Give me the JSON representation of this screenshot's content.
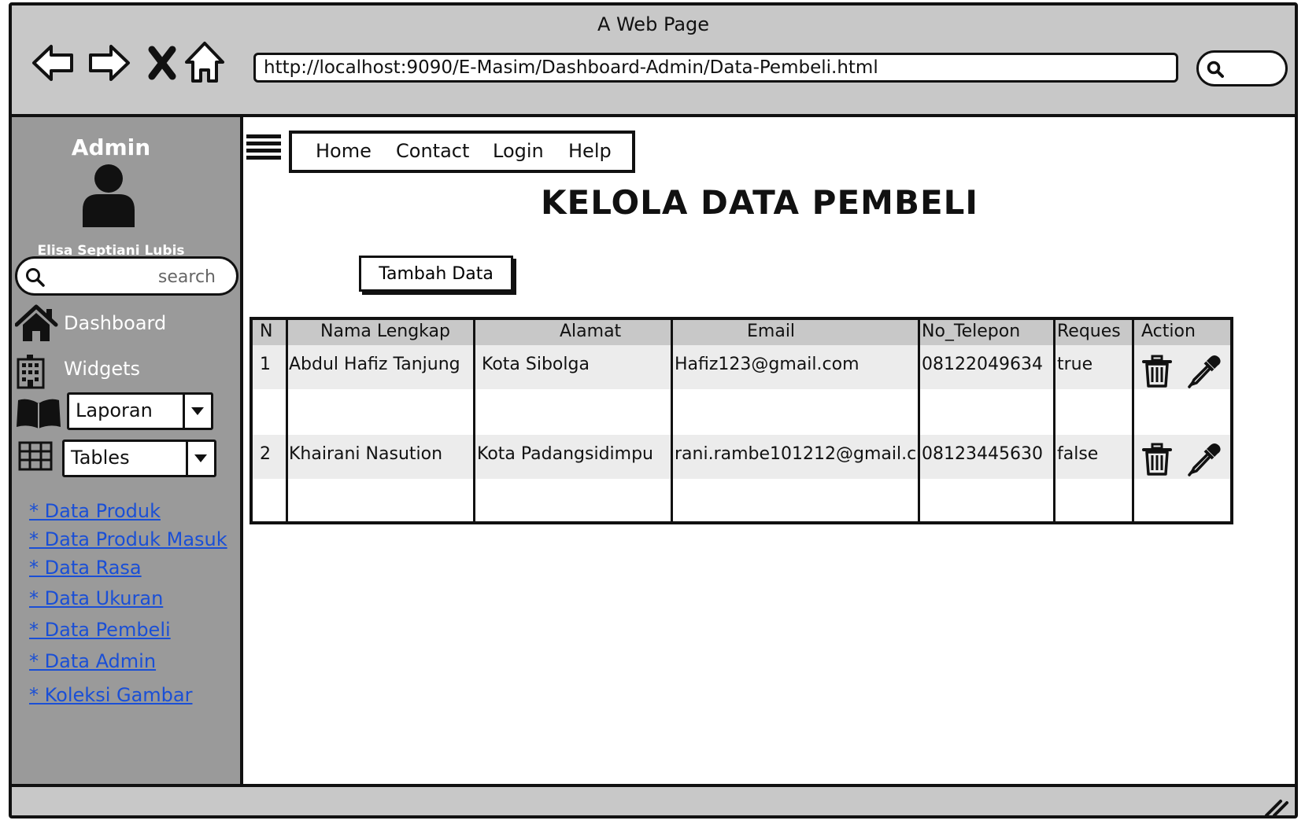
{
  "window": {
    "title": "A Web Page"
  },
  "browser": {
    "url": "http://localhost:9090/E-Masim/Dashboard-Admin/Data-Pembeli.html"
  },
  "sidebar": {
    "title": "Admin",
    "user_name": "Elisa Septiani Lubis",
    "search_placeholder": "search",
    "menu": {
      "dashboard": "Dashboard",
      "widgets": "Widgets",
      "laporan": "Laporan",
      "tables": "Tables"
    },
    "links": [
      "* Data Produk",
      "* Data Produk Masuk",
      "* Data Rasa",
      "* Data Ukuran",
      "* Data Pembeli",
      "* Data Admin",
      "* Koleksi Gambar"
    ]
  },
  "topnav": [
    "Home",
    "Contact",
    "Login",
    "Help"
  ],
  "page": {
    "title": "KELOLA DATA PEMBELI",
    "add_button": "Tambah Data"
  },
  "table": {
    "headers": [
      "N",
      "Nama Lengkap",
      "Alamat",
      "Email",
      "No_Telepon",
      "Reques",
      "Action"
    ],
    "rows": [
      [
        "1",
        "Abdul Hafiz Tanjung",
        "Kota Sibolga",
        "Hafiz123@gmail.com",
        "08122049634",
        "true"
      ],
      [
        "2",
        "Khairani Nasution",
        "Kota Padangsidimpu",
        "rani.rambe101212@gmail.c",
        "08123445630",
        "false"
      ]
    ]
  },
  "icons": {
    "back": "arrow-left-icon",
    "forward": "arrow-right-icon",
    "stop": "close-icon",
    "home": "home-icon",
    "search": "search-icon",
    "menu": "hamburger-icon",
    "delete": "trash-icon",
    "edit": "eyedropper-icon"
  }
}
